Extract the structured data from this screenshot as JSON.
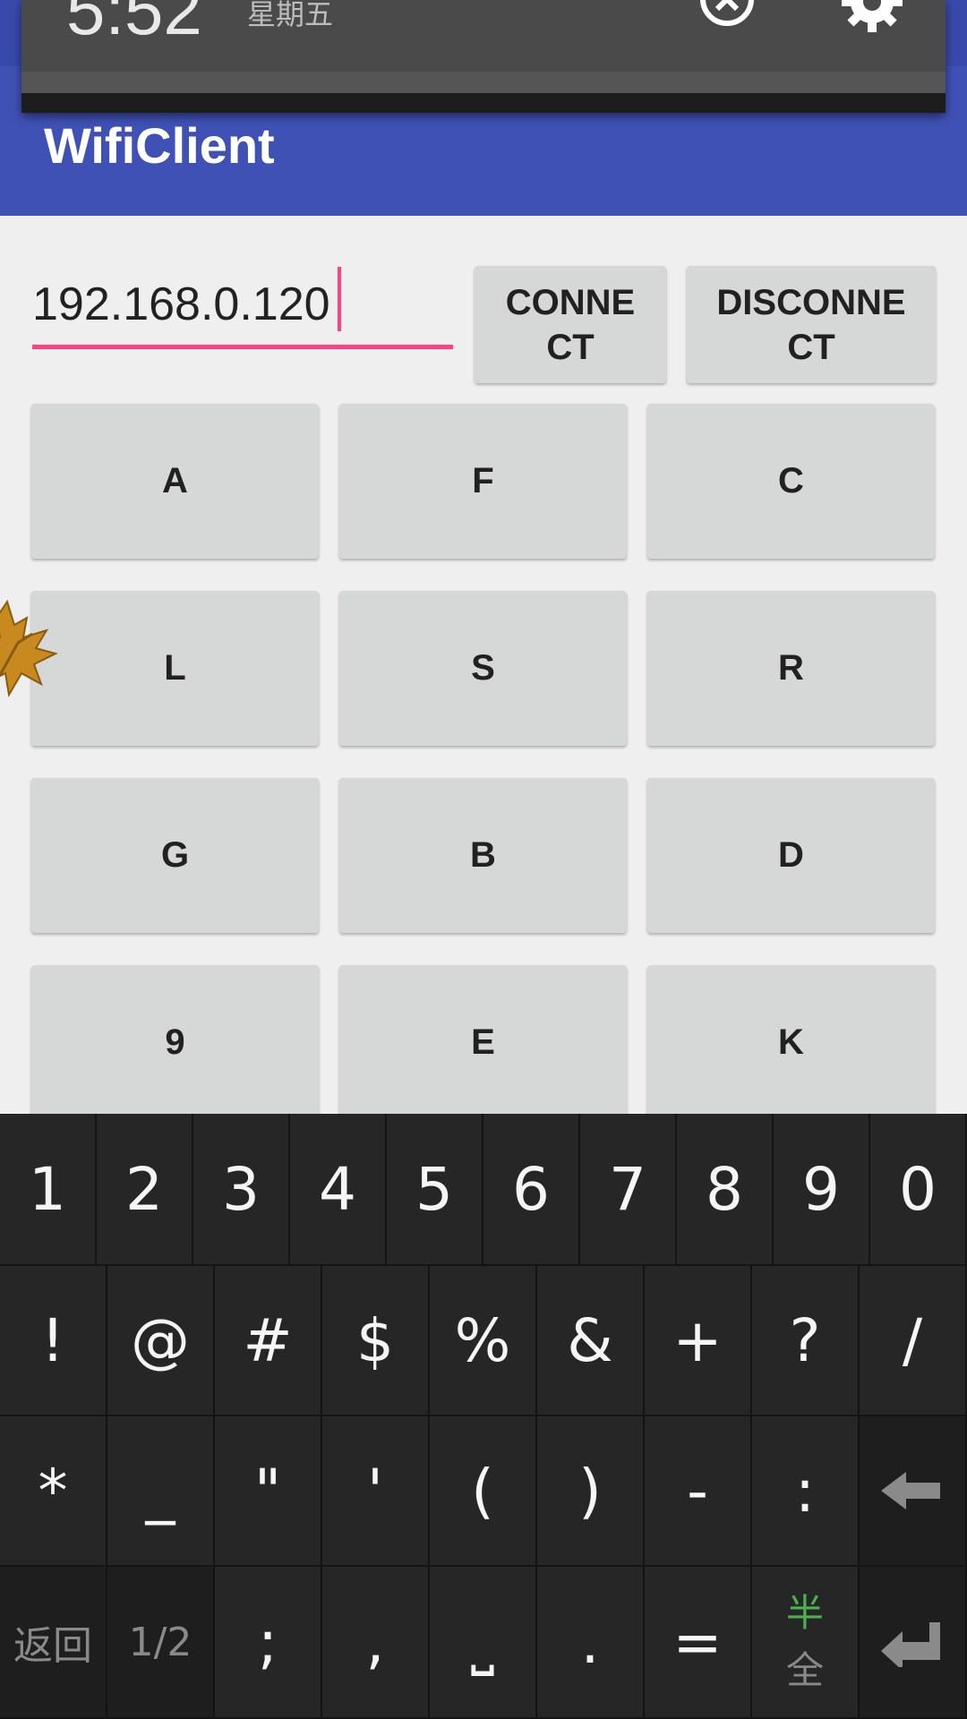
{
  "notification_shade": {
    "time": "5:52",
    "day": "星期五"
  },
  "app": {
    "title": "WifiClient"
  },
  "connection": {
    "ip_value": "192.168.0.120",
    "connect_label": "CONNE\nCT",
    "disconnect_label": "DISCONNE\nCT"
  },
  "buttons": [
    "A",
    "F",
    "C",
    "L",
    "S",
    "R",
    "G",
    "B",
    "D",
    "9",
    "E",
    "K"
  ],
  "keyboard": {
    "row1": [
      "1",
      "2",
      "3",
      "4",
      "5",
      "6",
      "7",
      "8",
      "9",
      "0"
    ],
    "row2": [
      "!",
      "@",
      "#",
      "$",
      "%",
      "&",
      "+",
      "?",
      "/"
    ],
    "row3": [
      "*",
      "_",
      "\"",
      "'",
      "(",
      ")",
      "-",
      ":"
    ],
    "row4": {
      "back": "返回",
      "page": "1/2",
      "semicolon": ";",
      "comma": ",",
      "space": "⎵",
      "period": ".",
      "equals": "=",
      "half": "半",
      "full": "全"
    }
  },
  "colors": {
    "app_bar": "#3f51b5",
    "accent": "#ff4081",
    "button": "#d6d7d7",
    "keyboard": "#262626"
  }
}
